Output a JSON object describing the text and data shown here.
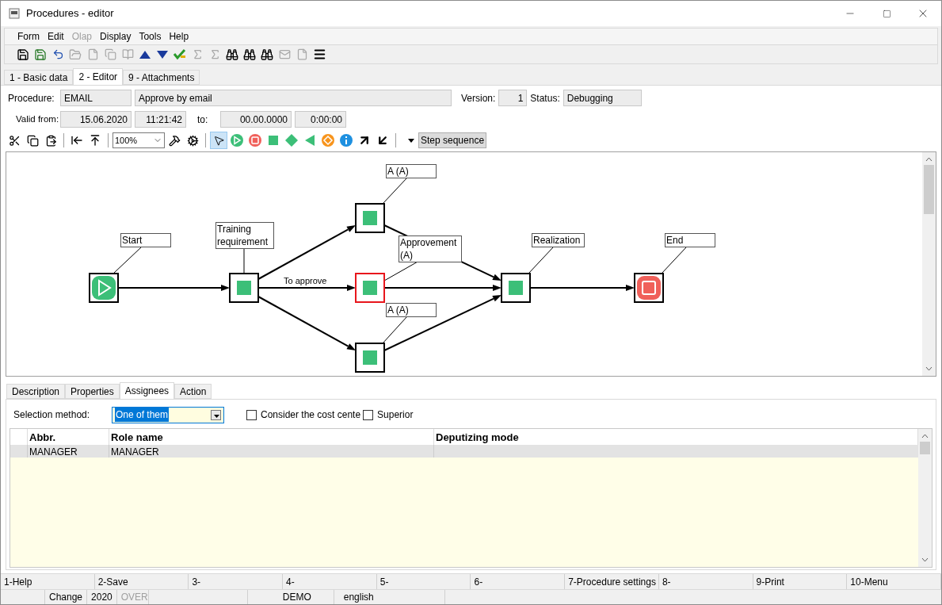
{
  "window": {
    "title": "Procedures - editor"
  },
  "menu": [
    {
      "label": "Form",
      "disabled": false
    },
    {
      "label": "Edit",
      "disabled": false
    },
    {
      "label": "Olap",
      "disabled": true
    },
    {
      "label": "Display",
      "disabled": false
    },
    {
      "label": "Tools",
      "disabled": false
    },
    {
      "label": "Help",
      "disabled": false
    }
  ],
  "tabs": [
    {
      "label": "1 - Basic data",
      "selected": false
    },
    {
      "label": "2 - Editor",
      "selected": true
    },
    {
      "label": "9 - Attachments",
      "selected": false
    }
  ],
  "header": {
    "procedure_label": "Procedure:",
    "procedure_code": "EMAIL",
    "procedure_name": "Approve by email",
    "version_label": "Version:",
    "version": "1",
    "status_label": "Status:",
    "status": "Debugging",
    "valid_from_label": "Valid from:",
    "valid_from_date": "15.06.2020",
    "valid_from_time": "11:21:42",
    "to_label": "to:",
    "to_date": "00.00.0000",
    "to_time": "0:00:00"
  },
  "editor_toolbar": {
    "zoom": "100%",
    "tools": [
      {
        "kind": "pointer",
        "selected": true
      },
      {
        "kind": "start",
        "selected": false
      },
      {
        "kind": "end",
        "selected": false
      },
      {
        "kind": "activity",
        "selected": false
      },
      {
        "kind": "decision",
        "selected": false
      },
      {
        "kind": "back",
        "selected": false
      },
      {
        "kind": "junction",
        "selected": false
      },
      {
        "kind": "info",
        "selected": false
      },
      {
        "kind": "arrow_out",
        "selected": false
      },
      {
        "kind": "arrow_in",
        "selected": false
      }
    ],
    "step_sequence": "Step sequence"
  },
  "diagram": {
    "nodes": [
      {
        "label": "Start",
        "kind": "start",
        "selected": false
      },
      {
        "label": "Training requirement",
        "kind": "activity",
        "selected": false
      },
      {
        "label": "A (A)",
        "kind": "activity",
        "selected": false
      },
      {
        "label": "Approvement (A)",
        "kind": "activity",
        "selected": true
      },
      {
        "label": "A (A)",
        "kind": "activity",
        "selected": false
      },
      {
        "label": "Realization",
        "kind": "activity",
        "selected": false
      },
      {
        "label": "End",
        "kind": "end",
        "selected": false
      }
    ],
    "edge_label": "To approve"
  },
  "detail_tabs": [
    {
      "label": "Description",
      "selected": false
    },
    {
      "label": "Properties",
      "selected": false
    },
    {
      "label": "Assignees",
      "selected": true
    },
    {
      "label": "Action",
      "selected": false
    }
  ],
  "assignees": {
    "selection_label": "Selection method:",
    "selection_value": "One of them",
    "options": [
      {
        "label": "Consider the cost cente",
        "checked": false
      },
      {
        "label": "Superior",
        "checked": false
      }
    ],
    "columns": [
      "Abbr.",
      "Role name",
      "Deputizing mode"
    ],
    "rows": [
      {
        "abbr": "MANAGER",
        "role_name": "MANAGER",
        "selected": true
      }
    ]
  },
  "function_keys": [
    "1-Help",
    "2-Save",
    "3-",
    "4-",
    "5-",
    "6-",
    "7-Procedure settings",
    "8-",
    "9-Print",
    "10-Menu"
  ],
  "status_bar": [
    {
      "text": "Change",
      "disabled": false
    },
    {
      "text": "2020",
      "disabled": false
    },
    {
      "text": "OVER",
      "disabled": true
    },
    {
      "text": "DEMO",
      "disabled": false
    },
    {
      "text": "english",
      "disabled": false
    }
  ]
}
